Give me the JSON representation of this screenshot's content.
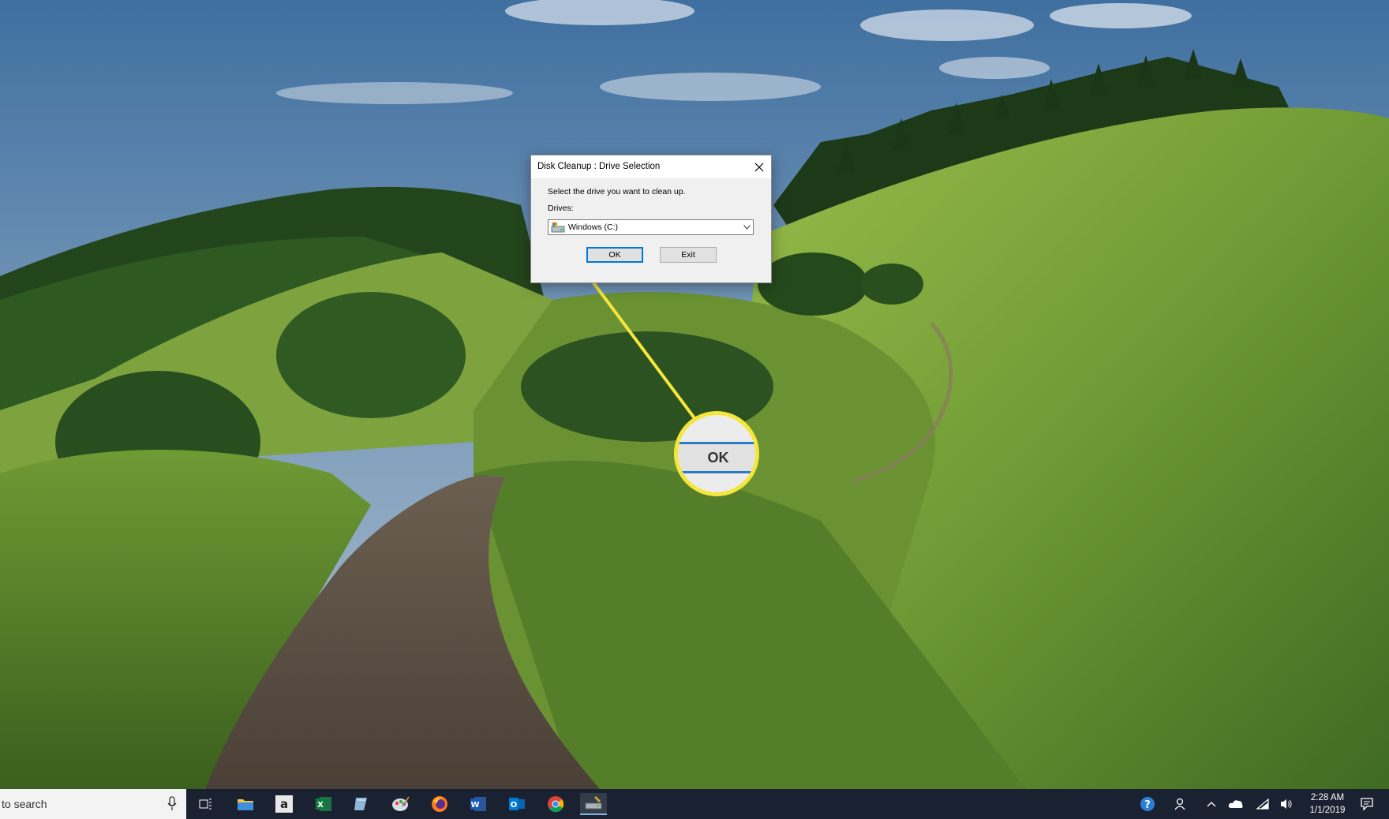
{
  "dialog": {
    "title": "Disk Cleanup : Drive Selection",
    "prompt": "Select the drive you want to clean up.",
    "drives_label": "Drives:",
    "selected_drive": "Windows (C:)",
    "ok_label": "OK",
    "exit_label": "Exit"
  },
  "callout": {
    "zoom_label": "OK",
    "color": "#f5e63c"
  },
  "taskbar": {
    "search_placeholder": "to search",
    "apps": [
      "task-view-icon",
      "file-explorer-icon",
      "amazon-icon",
      "excel-icon",
      "notepad-icon",
      "paint-icon",
      "firefox-icon",
      "word-icon",
      "outlook-icon",
      "chrome-icon",
      "disk-cleanup-icon"
    ],
    "time": "2:28 AM",
    "date": "1/1/2019"
  }
}
